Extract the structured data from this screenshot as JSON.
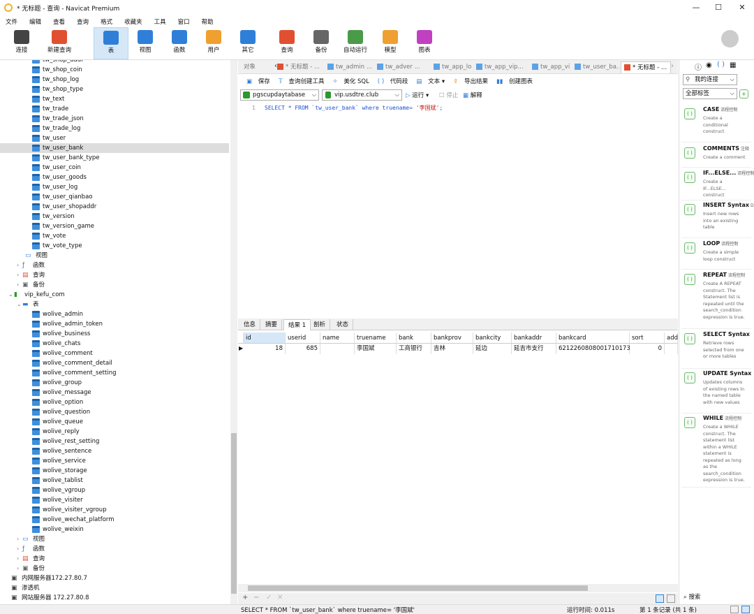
{
  "window": {
    "title": "* 无标题 - 查询 - Navicat Premium",
    "min": "—",
    "max": "☐",
    "close": "✕"
  },
  "menu": [
    "文件",
    "编辑",
    "查看",
    "查询",
    "格式",
    "收藏夹",
    "工具",
    "窗口",
    "帮助"
  ],
  "toolbar": [
    {
      "label": "连接",
      "icon": "plug-icon",
      "color": "#444"
    },
    {
      "label": "新建查询",
      "icon": "new-query-icon",
      "color": "#e05030"
    },
    {
      "label": "表",
      "icon": "table-icon",
      "color": "#2f7fd8"
    },
    {
      "label": "视图",
      "icon": "view-icon",
      "color": "#2f7fd8"
    },
    {
      "label": "函数",
      "icon": "function-icon",
      "color": "#2f7fd8"
    },
    {
      "label": "用户",
      "icon": "user-icon",
      "color": "#f0a030"
    },
    {
      "label": "其它",
      "icon": "tools-icon",
      "color": "#2f7fd8"
    },
    {
      "label": "查询",
      "icon": "query-icon",
      "color": "#e05030"
    },
    {
      "label": "备份",
      "icon": "backup-icon",
      "color": "#666"
    },
    {
      "label": "自动运行",
      "icon": "robot-icon",
      "color": "#4a9a4a"
    },
    {
      "label": "模型",
      "icon": "model-icon",
      "color": "#f0a030"
    },
    {
      "label": "图表",
      "icon": "chart-icon",
      "color": "#c040c0"
    }
  ],
  "tree": {
    "tables_a": [
      "tw_shop_addr",
      "tw_shop_coin",
      "tw_shop_log",
      "tw_shop_type",
      "tw_text",
      "tw_trade",
      "tw_trade_json",
      "tw_trade_log",
      "tw_user",
      "tw_user_bank",
      "tw_user_bank_type",
      "tw_user_coin",
      "tw_user_goods",
      "tw_user_log",
      "tw_user_qianbao",
      "tw_user_shopaddr",
      "tw_version",
      "tw_version_game",
      "tw_vote",
      "tw_vote_type"
    ],
    "selected": "tw_user_bank",
    "views_label": "视图",
    "functions_label": "函数",
    "queries_label": "查询",
    "backups_label": "备份",
    "db2": "vip_kefu_com",
    "tables_label": "表",
    "tables_b": [
      "wolive_admin",
      "wolive_admin_token",
      "wolive_business",
      "wolive_chats",
      "wolive_comment",
      "wolive_comment_detail",
      "wolive_comment_setting",
      "wolive_group",
      "wolive_message",
      "wolive_option",
      "wolive_question",
      "wolive_queue",
      "wolive_reply",
      "wolive_rest_setting",
      "wolive_sentence",
      "wolive_service",
      "wolive_storage",
      "wolive_tablist",
      "wolive_vgroup",
      "wolive_visiter",
      "wolive_visiter_vgroup",
      "wolive_wechat_platform",
      "wolive_weixin"
    ],
    "servers": [
      "内网服务器172.27.80.7",
      "渗透机",
      "网站服务器 172.27.80.8"
    ]
  },
  "tabs": [
    "对象",
    "* 无标题 - ...",
    "tw_admin ...",
    "tw_adver ...",
    "tw_app_lo...",
    "tw_app_vip...",
    "tw_app_vip...",
    "tw_user_ba...",
    "* 无标题 - ..."
  ],
  "query_toolbar": {
    "save": "保存",
    "builder": "查询创建工具",
    "beautify": "美化 SQL",
    "snippet": "代码段",
    "text": "文本",
    "export": "导出结果",
    "create_chart": "创建图表"
  },
  "connection": {
    "conn": "pgscupdaytabase",
    "db": "vip.usdtre.club",
    "run": "运行",
    "stop": "停止",
    "explain": "解释"
  },
  "editor": {
    "line": "1",
    "sql_prefix": "SELECT * FROM `tw_user_bank` where truename= ",
    "sql_string": "'李国斌'",
    "sql_end": ";"
  },
  "result_tabs": [
    "信息",
    "摘要",
    "结果 1",
    "剖析",
    "状态"
  ],
  "grid": {
    "columns": [
      "id",
      "userid",
      "name",
      "truename",
      "bank",
      "bankprov",
      "bankcity",
      "bankaddr",
      "bankcard",
      "sort",
      "add"
    ],
    "rows": [
      [
        "18",
        "685",
        "",
        "李国斌",
        "工商银行",
        "吉林",
        "延边",
        "延吉市支行",
        "6212260808001710173",
        "0",
        ""
      ]
    ]
  },
  "bottom": {
    "add": "+",
    "remove": "−",
    "ok": "✓",
    "cancel": "✕"
  },
  "status": {
    "sql": "SELECT * FROM `tw_user_bank` where truename= '李国斌'",
    "time": "运行时间: 0.011s",
    "records": "第 1 条记录 (共 1 条)"
  },
  "right_panel": {
    "my_conn": "我的连接",
    "all_tags": "全部标签",
    "search": "搜索",
    "snippets": [
      {
        "title": "CASE",
        "tag": "流程控制",
        "desc": "Create a conditional construct"
      },
      {
        "title": "COMMENTS",
        "tag": "注释",
        "desc": "Create a comment"
      },
      {
        "title": "IF...ELSE...",
        "tag": "流程控制",
        "desc": "Create a IF...ELSE... construct"
      },
      {
        "title": "INSERT Syntax",
        "tag": "DI",
        "desc": "Insert new rows into an existing table"
      },
      {
        "title": "LOOP",
        "tag": "流程控制",
        "desc": "Create a simple loop construct"
      },
      {
        "title": "REPEAT",
        "tag": "流程控制",
        "desc": "Create A REPEAT construct. The Statement list is repeated until the search_condition expression is true."
      },
      {
        "title": "SELECT Syntax",
        "tag": "",
        "desc": "Retrieve rows selected from one or more tables"
      },
      {
        "title": "UPDATE Syntax",
        "tag": "",
        "desc": "Updates columns of existing rows in the named table with new values"
      },
      {
        "title": "WHILE",
        "tag": "流程控制",
        "desc": "Create a WHILE construct. The statement list within a WHILE statement is repeated as long as the search_condition expression is true."
      }
    ]
  }
}
